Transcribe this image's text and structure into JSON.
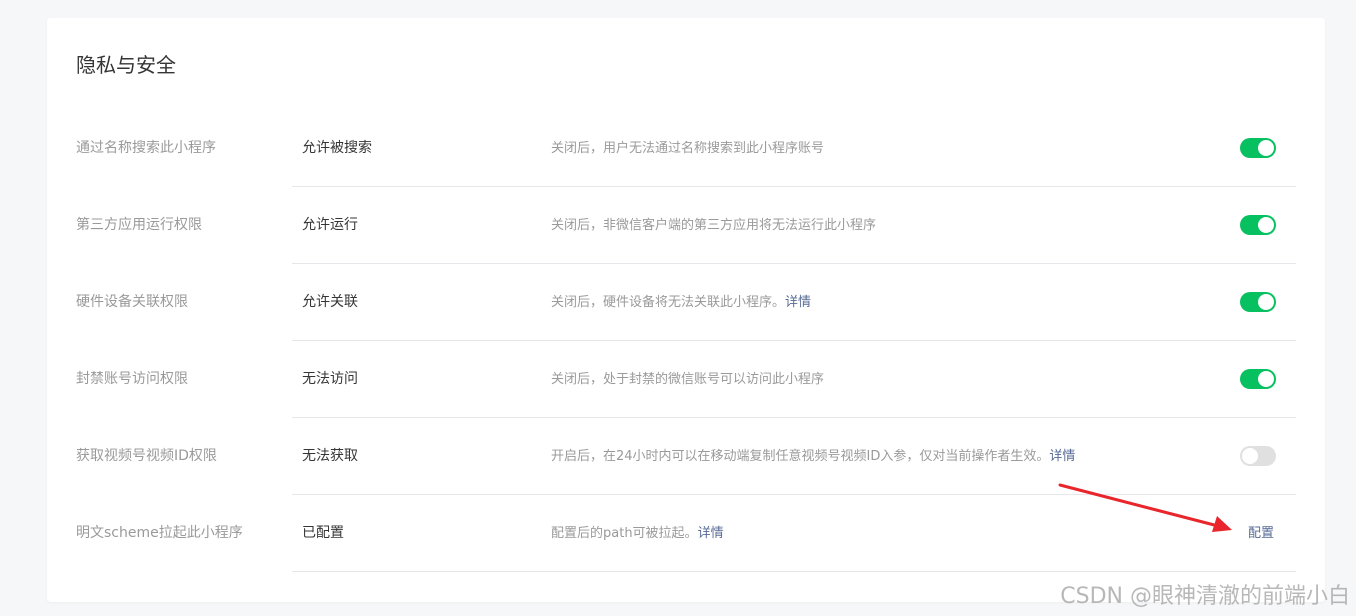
{
  "section": {
    "title": "隐私与安全"
  },
  "rows": [
    {
      "label": "通过名称搜索此小程序",
      "status": "允许被搜索",
      "description": "关闭后，用户无法通过名称搜索到此小程序账号",
      "link": "",
      "toggle_on": true
    },
    {
      "label": "第三方应用运行权限",
      "status": "允许运行",
      "description": "关闭后，非微信客户端的第三方应用将无法运行此小程序",
      "link": "",
      "toggle_on": true
    },
    {
      "label": "硬件设备关联权限",
      "status": "允许关联",
      "description": "关闭后，硬件设备将无法关联此小程序。",
      "link": "详情",
      "toggle_on": true
    },
    {
      "label": "封禁账号访问权限",
      "status": "无法访问",
      "description": "关闭后，处于封禁的微信账号可以访问此小程序",
      "link": "",
      "toggle_on": true
    },
    {
      "label": "获取视频号视频ID权限",
      "status": "无法获取",
      "description": "开启后，在24小时内可以在移动端复制任意视频号视频ID入参，仅对当前操作者生效。",
      "link": "详情",
      "toggle_on": false
    },
    {
      "label": "明文scheme拉起此小程序",
      "status": "已配置",
      "description": "配置后的path可被拉起。",
      "link": "详情",
      "action": "配置"
    }
  ],
  "watermark": "CSDN @眼神清澈的前端小白",
  "colors": {
    "toggle_on": "#07c160",
    "toggle_off": "#e0e0e0",
    "link": "#576b95",
    "annotation_arrow": "#e8262b"
  }
}
